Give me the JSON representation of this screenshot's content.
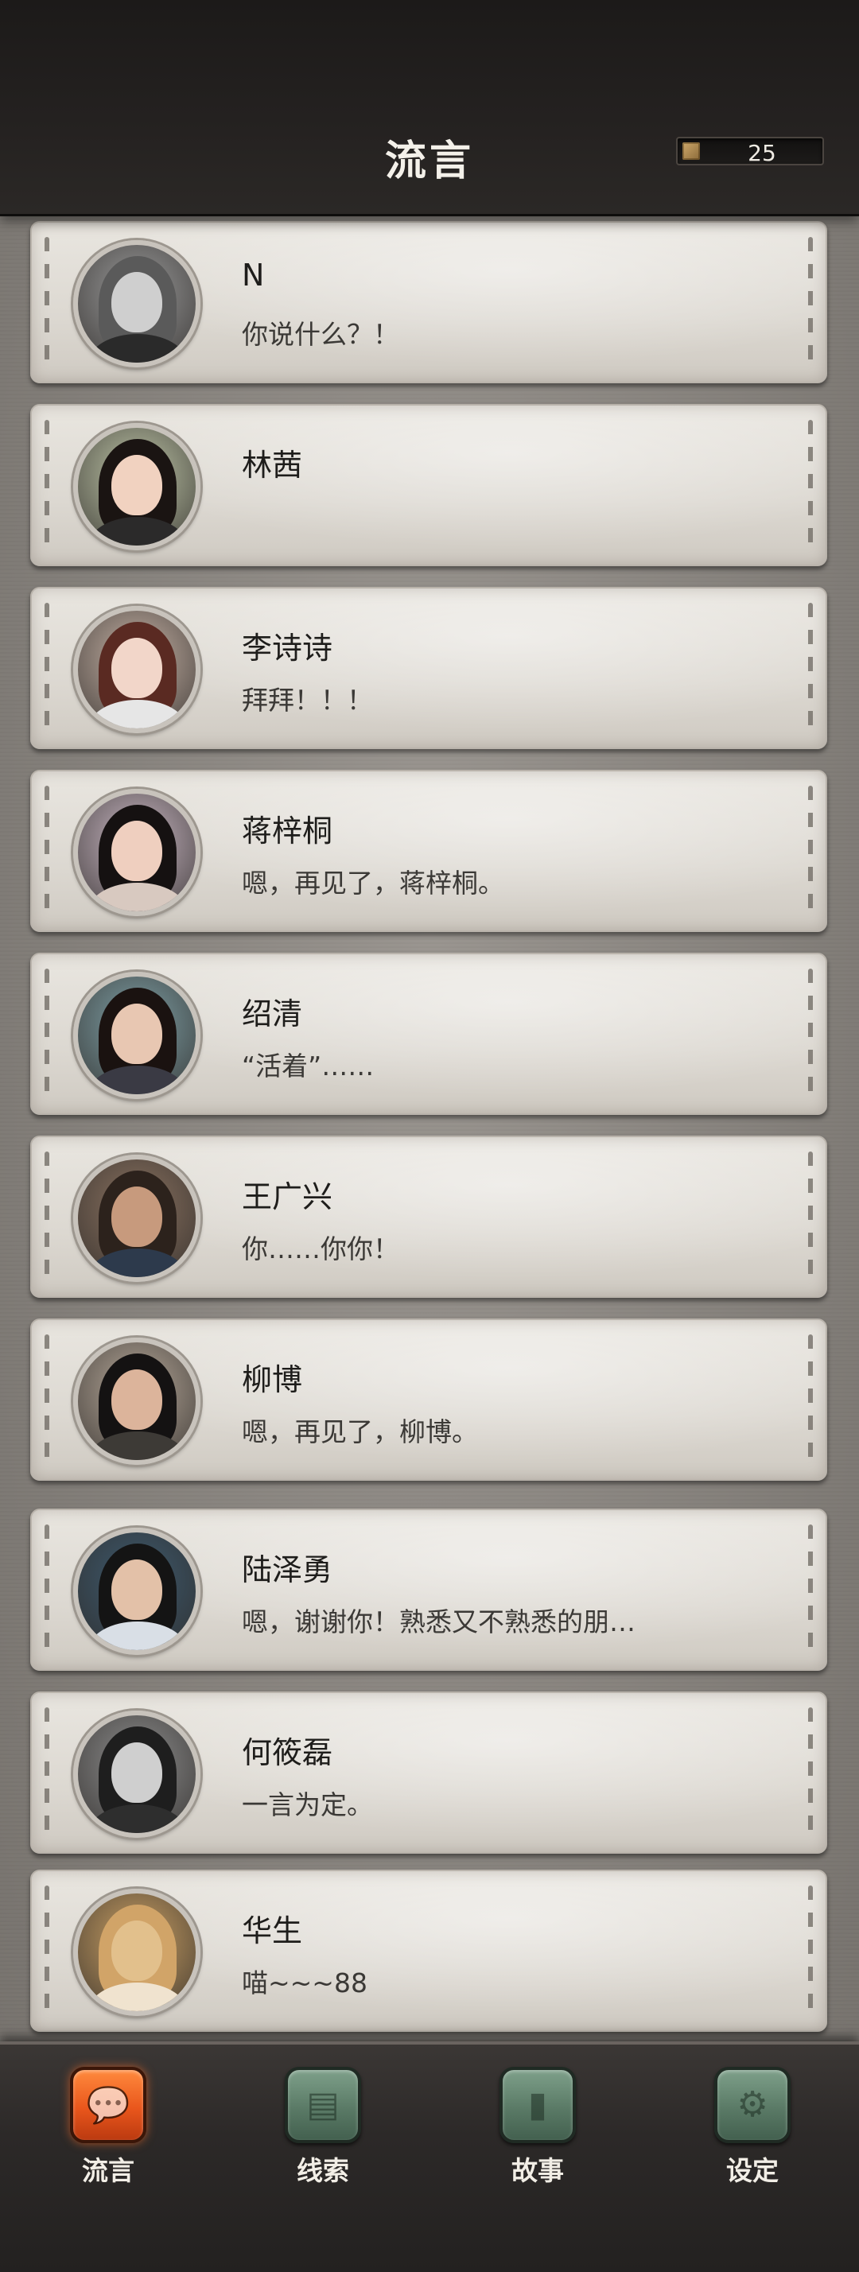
{
  "header": {
    "title": "流言",
    "currency_value": "25"
  },
  "contacts": [
    {
      "name": "N",
      "message": "你说什么？！",
      "skin": "#cfcfcf",
      "hair": "#5a5a5a",
      "body": "#2a2a2a",
      "bg": "#9a9a9a"
    },
    {
      "name": "林茜",
      "message": "",
      "skin": "#f1d2c0",
      "hair": "#1a1412",
      "body": "#2b2a2a",
      "bg": "#bfc6a8"
    },
    {
      "name": "李诗诗",
      "message": "拜拜！！！",
      "skin": "#f2d6c9",
      "hair": "#5a2a22",
      "body": "#e6e6e6",
      "bg": "#c7b3a6"
    },
    {
      "name": "蒋梓桐",
      "message": "嗯，再见了，蒋梓桐。",
      "skin": "#efcfbf",
      "hair": "#151111",
      "body": "#d8c9c0",
      "bg": "#c9b7c3"
    },
    {
      "name": "绍清",
      "message": "“活着”……",
      "skin": "#e8c7b2",
      "hair": "#1a1210",
      "body": "#3a3a44",
      "bg": "#7fa0a6"
    },
    {
      "name": "王广兴",
      "message": "你……你你！",
      "skin": "#c79a7d",
      "hair": "#2c221c",
      "body": "#2d3a4c",
      "bg": "#8a7260"
    },
    {
      "name": "柳博",
      "message": "嗯，再见了，柳博。",
      "skin": "#dcb49b",
      "hair": "#141212",
      "body": "#3d3a36",
      "bg": "#b7a99a"
    },
    {
      "name": "陆泽勇",
      "message": "嗯，谢谢你！熟悉又不熟悉的朋…",
      "skin": "#e3c1a8",
      "hair": "#141414",
      "body": "#d9dfe6",
      "bg": "#3e5a6e"
    },
    {
      "name": "何筱磊",
      "message": "一言为定。",
      "skin": "#cfcfcf",
      "hair": "#1e1e1e",
      "body": "#2e2e2e",
      "bg": "#8d8d8d"
    },
    {
      "name": "华生",
      "message": "喵~~~88",
      "skin": "#e2c08c",
      "hair": "#d1a468",
      "body": "#f0e3cf",
      "bg": "#caa064"
    }
  ],
  "nav": [
    {
      "label": "流言",
      "glyph": "💬",
      "active": true
    },
    {
      "label": "线索",
      "glyph": "▤",
      "active": false
    },
    {
      "label": "故事",
      "glyph": "▮",
      "active": false
    },
    {
      "label": "设定",
      "glyph": "⚙",
      "active": false
    }
  ],
  "colors": {
    "header_bg": "#242120",
    "card_bg": "#e2dfd9",
    "nav_active": "#e9561c",
    "nav_inactive": "#5a7a66"
  }
}
